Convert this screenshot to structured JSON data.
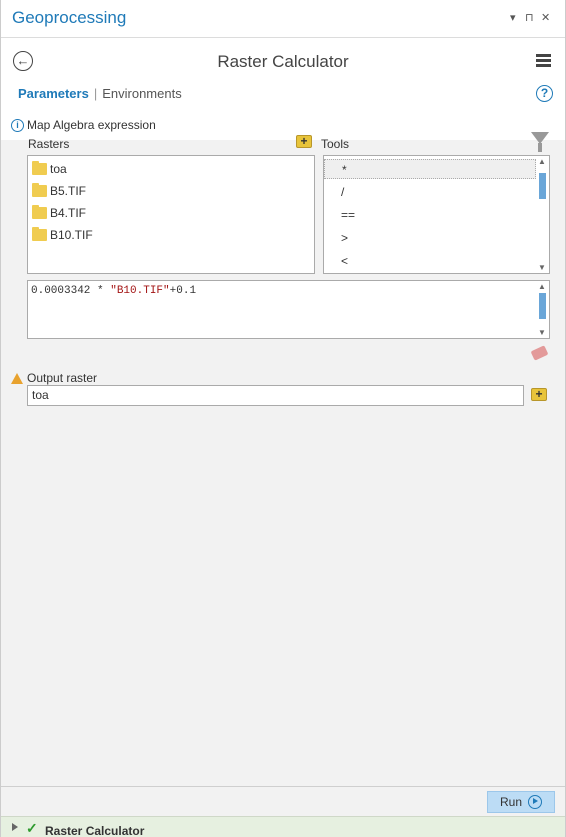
{
  "panel": {
    "title": "Geoprocessing",
    "controls": [
      "▾",
      "⊓",
      "✕"
    ]
  },
  "tool": {
    "title": "Raster Calculator"
  },
  "tabs": {
    "parameters": "Parameters",
    "environments": "Environments"
  },
  "expression": {
    "label": "Map Algebra expression",
    "rasters_label": "Rasters",
    "tools_label": "Tools",
    "rasters": [
      "toa",
      "B5.TIF",
      "B4.TIF",
      "B10.TIF"
    ],
    "tools": [
      "*",
      "/",
      "==",
      ">",
      "<"
    ],
    "text_prefix": "0.0003342 * ",
    "text_raster": "\"B10.TIF\"",
    "text_suffix": "+0.1"
  },
  "output": {
    "label": "Output raster",
    "value": "toa"
  },
  "run": {
    "label": "Run"
  },
  "status": {
    "text": "Raster Calculator"
  },
  "colors": {
    "accent": "#1f7ab8",
    "success": "#2e9a2e",
    "warning": "#e8a22e"
  }
}
